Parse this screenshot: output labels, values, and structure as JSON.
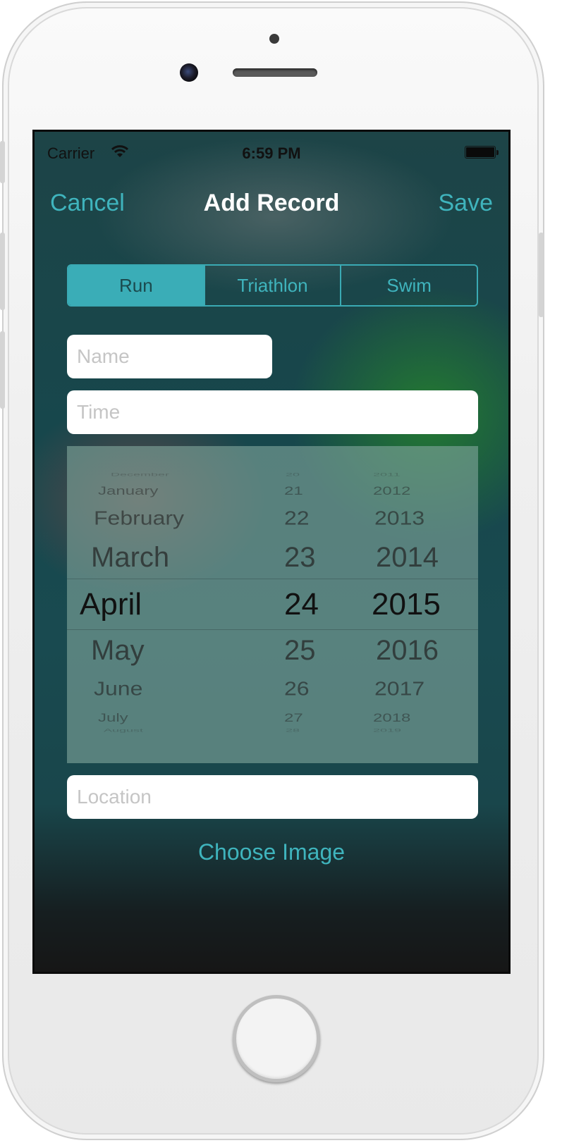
{
  "status_bar": {
    "carrier": "Carrier",
    "time": "6:59 PM"
  },
  "nav": {
    "cancel": "Cancel",
    "title": "Add Record",
    "save": "Save"
  },
  "segments": [
    {
      "label": "Run",
      "selected": true
    },
    {
      "label": "Triathlon",
      "selected": false
    },
    {
      "label": "Swim",
      "selected": false
    }
  ],
  "form": {
    "name_placeholder": "Name",
    "time_placeholder": "Time",
    "location_placeholder": "Location"
  },
  "picker": {
    "months": [
      "December",
      "January",
      "February",
      "March",
      "April",
      "May",
      "June",
      "July",
      "August"
    ],
    "days": [
      "20",
      "21",
      "22",
      "23",
      "24",
      "25",
      "26",
      "27",
      "28"
    ],
    "years": [
      "2011",
      "2012",
      "2013",
      "2014",
      "2015",
      "2016",
      "2017",
      "2018",
      "2019"
    ],
    "selected": {
      "month": "April",
      "day": "24",
      "year": "2015"
    }
  },
  "choose_image": "Choose Image",
  "colors": {
    "accent": "#3fb4bd",
    "segment_selected": "#3aadb7"
  }
}
